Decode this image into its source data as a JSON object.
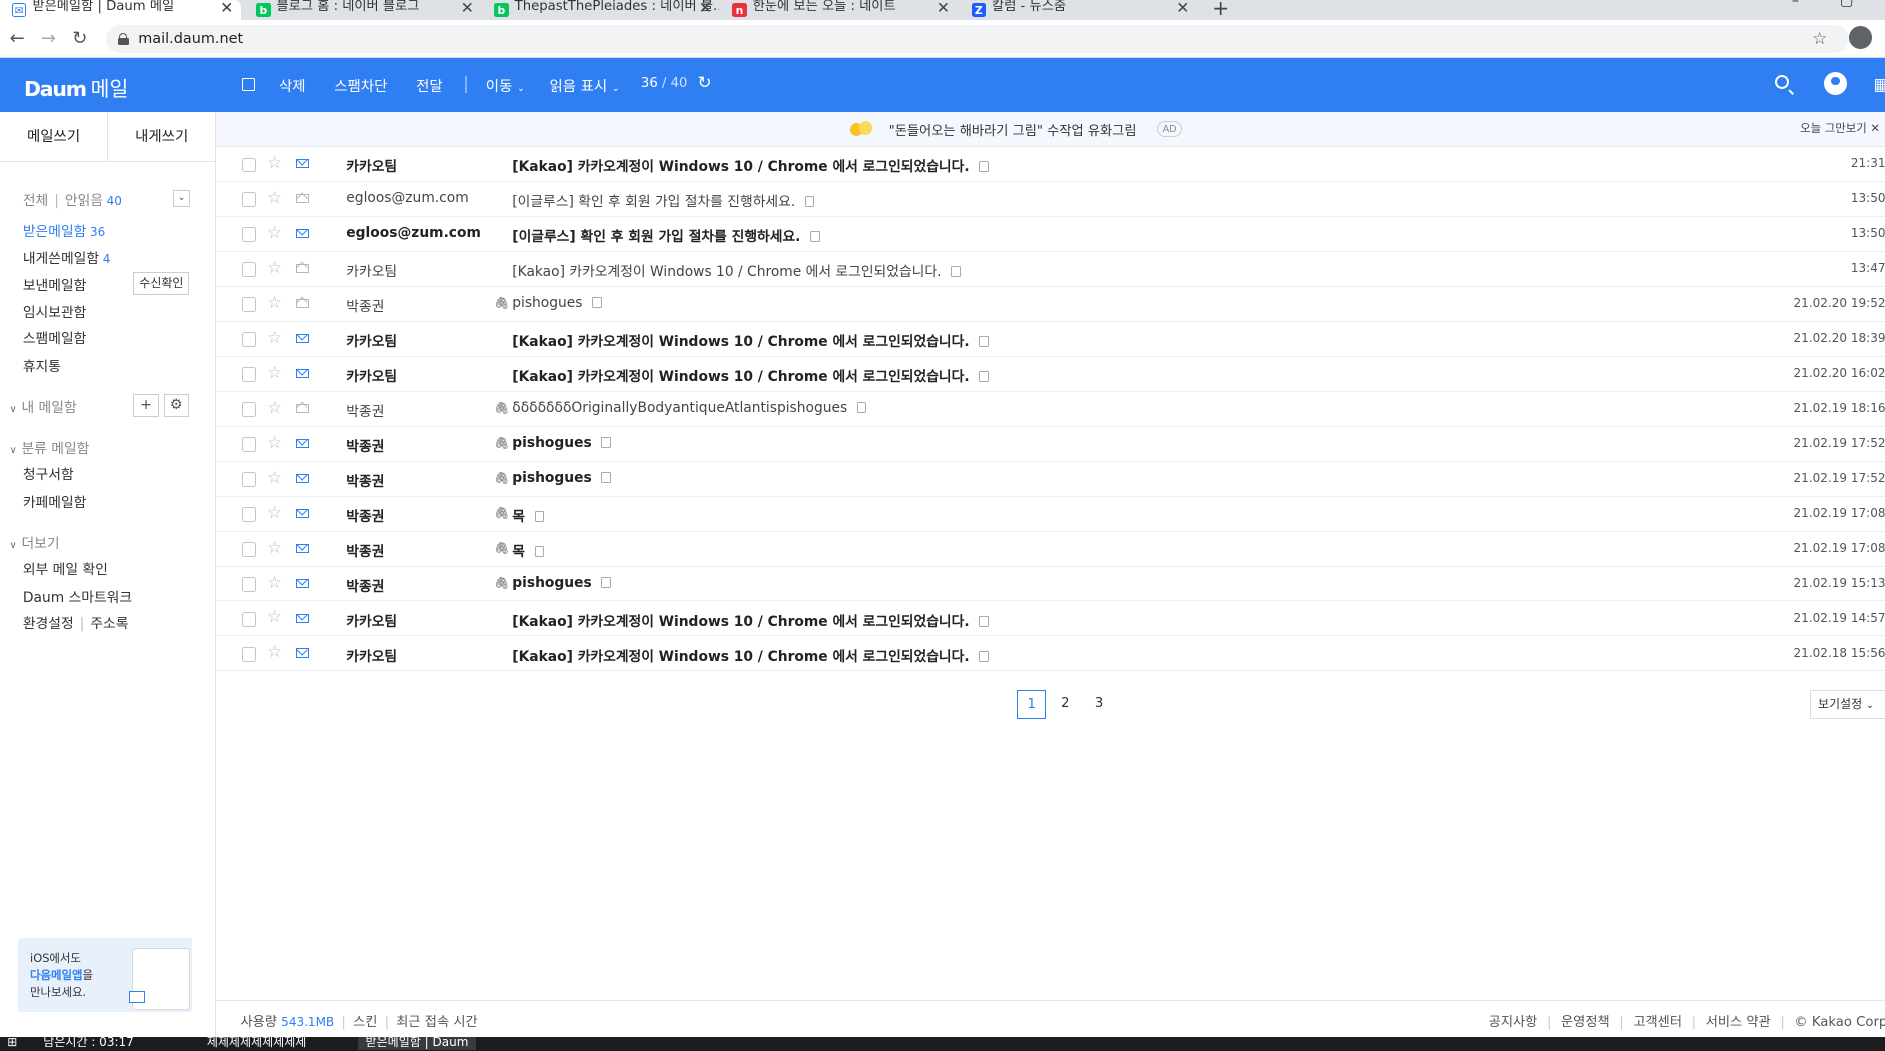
{
  "browser": {
    "tabs": [
      {
        "title": "받은메일함 | Daum 메일",
        "active": true,
        "icon": "mail-icon",
        "color": "#2f7ff2"
      },
      {
        "title": "블로그 홈 : 네이버 블로그",
        "active": false,
        "icon": "naver-blog-icon",
        "color": "#03c75a"
      },
      {
        "title": "ThepastThePleiades : 네이버 블...",
        "active": false,
        "icon": "naver-blog-icon",
        "color": "#03c75a"
      },
      {
        "title": "한눈에 보는 오늘 : 네이트",
        "active": false,
        "icon": "nate-icon",
        "color": "#e8323c"
      },
      {
        "title": "칼럼 - 뉴스줌",
        "active": false,
        "icon": "zum-icon",
        "color": "#1f5cff"
      }
    ],
    "url": "mail.daum.net"
  },
  "header": {
    "logo": "Daum",
    "logo_suffix": "메일",
    "toolbar": {
      "delete": "삭제",
      "spam": "스팸차단",
      "forward": "전달",
      "move": "이동",
      "mark_read": "읽음 표시"
    },
    "page_count": "36",
    "page_total": "/ 40",
    "accent": "#2f7ff2"
  },
  "sidebar": {
    "compose": "메일쓰기",
    "compose_self": "내게쓰기",
    "all": "전체",
    "unread_label": "안읽음",
    "unread_count": "40",
    "folders": [
      {
        "label": "받은메일함",
        "count": "36",
        "selected": true
      },
      {
        "label": "내게쓴메일함",
        "count": "4"
      },
      {
        "label": "보낸메일함",
        "extra": "수신확인"
      },
      {
        "label": "임시보관함"
      },
      {
        "label": "스팸메일함"
      },
      {
        "label": "휴지통"
      }
    ],
    "my_mailbox": "내 메일함",
    "category_mailbox": "분류 메일함",
    "categories": [
      "청구서함",
      "카페메일함"
    ],
    "more": "더보기",
    "more_items": [
      "외부 메일 확인",
      "Daum 스마트워크"
    ],
    "settings": "환경설정",
    "address_book": "주소록",
    "promo": {
      "line1": "iOS에서도",
      "line2": "다음메일앱",
      "line2_suffix": "을",
      "line3": "만나보세요."
    }
  },
  "ad": {
    "text": "\"돈들어오는 해바라기 그림\" 수작업 유화그림",
    "badge": "AD",
    "close": "오늘 그만보기"
  },
  "emails": [
    {
      "from": "카카오팀",
      "subject": "[Kakao] 카카오계정이 Windows 10 / Chrome 에서 로그인되었습니다.",
      "date": "21:31",
      "unread": true,
      "attach": false
    },
    {
      "from": "egloos@zum.com",
      "subject": "[이글루스] 확인 후 회원 가입 절차를 진행하세요.",
      "date": "13:50",
      "unread": false,
      "attach": false
    },
    {
      "from": "egloos@zum.com",
      "subject": "[이글루스] 확인 후 회원 가입 절차를 진행하세요.",
      "date": "13:50",
      "unread": true,
      "attach": false
    },
    {
      "from": "카카오팀",
      "subject": "[Kakao] 카카오계정이 Windows 10 / Chrome 에서 로그인되었습니다.",
      "date": "13:47",
      "unread": false,
      "attach": false
    },
    {
      "from": "박종권",
      "subject": "pishogues",
      "date": "21.02.20 19:52",
      "unread": false,
      "attach": true
    },
    {
      "from": "카카오팀",
      "subject": "[Kakao] 카카오계정이 Windows 10 / Chrome 에서 로그인되었습니다.",
      "date": "21.02.20 18:39",
      "unread": true,
      "attach": false
    },
    {
      "from": "카카오팀",
      "subject": "[Kakao] 카카오계정이 Windows 10 / Chrome 에서 로그인되었습니다.",
      "date": "21.02.20 16:02",
      "unread": true,
      "attach": false
    },
    {
      "from": "박종권",
      "subject": "δδδδδδδOriginallyBodyantiqueAtlantispishogues",
      "date": "21.02.19 18:16",
      "unread": false,
      "attach": true
    },
    {
      "from": "박종권",
      "subject": "pishogues",
      "date": "21.02.19 17:52",
      "unread": true,
      "attach": true
    },
    {
      "from": "박종권",
      "subject": "pishogues",
      "date": "21.02.19 17:52",
      "unread": true,
      "attach": true
    },
    {
      "from": "박종권",
      "subject": "목",
      "date": "21.02.19 17:08",
      "unread": true,
      "attach": true
    },
    {
      "from": "박종권",
      "subject": "목",
      "date": "21.02.19 17:08",
      "unread": true,
      "attach": true
    },
    {
      "from": "박종권",
      "subject": "pishogues",
      "date": "21.02.19 15:13",
      "unread": true,
      "attach": true
    },
    {
      "from": "카카오팀",
      "subject": "[Kakao] 카카오계정이 Windows 10 / Chrome 에서 로그인되었습니다.",
      "date": "21.02.19 14:57",
      "unread": true,
      "attach": false
    },
    {
      "from": "카카오팀",
      "subject": "[Kakao] 카카오계정이 Windows 10 / Chrome 에서 로그인되었습니다.",
      "date": "21.02.18 15:56",
      "unread": true,
      "attach": false
    }
  ],
  "pagination": {
    "pages": [
      "1",
      "2",
      "3"
    ],
    "current": "1"
  },
  "view_settings": "보기설정",
  "footer": {
    "usage_label": "사용량",
    "usage_value": "543.1MB",
    "skin": "스킨",
    "recent_access": "최근 접속 시간",
    "links": [
      "공지사항",
      "운영정책",
      "고객센터",
      "서비스 약관"
    ],
    "copyright": "© Kakao Corp."
  },
  "taskbar": {
    "item1": "남은시간 : 03:17",
    "item2": "제제제제제제제제제",
    "item3": "받은메일함 | Daum"
  }
}
